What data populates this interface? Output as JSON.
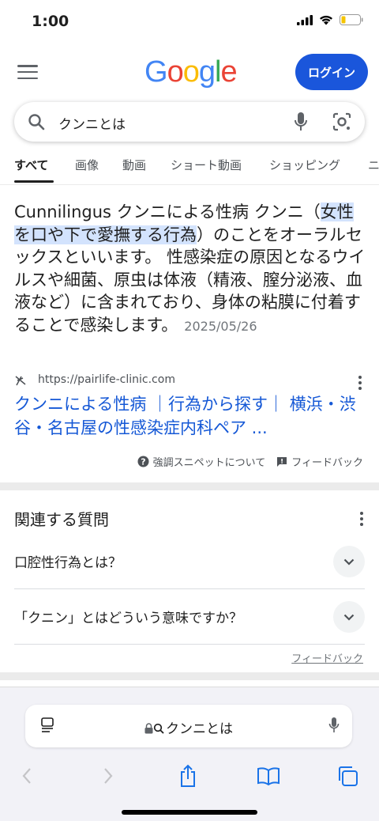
{
  "status": {
    "time": "1:00"
  },
  "header": {
    "logo": "Google",
    "login_label": "ログイン"
  },
  "search": {
    "query": "クンニとは"
  },
  "tabs": [
    "すべて",
    "画像",
    "動画",
    "ショート動画",
    "ショッピング",
    "ニ"
  ],
  "snippet": {
    "pre": "Cunnilingus クンニによる性病 クンニ（",
    "highlight": "女性を口や下で愛撫する行為",
    "post": "）のことをオーラルセックスといいます。 性感染症の原因となるウイルスや細菌、原虫は体液（精液、膣分泌液、血液など）に含まれており、身体の粘膜に付着することで感染します。",
    "date": "2025/05/26",
    "source_url": "https://pairlife-clinic.com",
    "link_title": "クンニによる性病 ｜行為から探す｜ 横浜・渋谷・名古屋の性感染症内科ペア ..."
  },
  "snippet_footer": {
    "about": "強調スニペットについて",
    "feedback": "フィードバック"
  },
  "paa": {
    "title": "関連する質問",
    "questions": [
      "口腔性行為とは？",
      "「クニン」とはどういう意味ですか？"
    ],
    "feedback": "フィードバック"
  },
  "browser": {
    "url": "クンニとは"
  },
  "colors": {
    "accent": "#1a56db",
    "link": "#1558d6",
    "highlight": "#d3e3fd"
  }
}
